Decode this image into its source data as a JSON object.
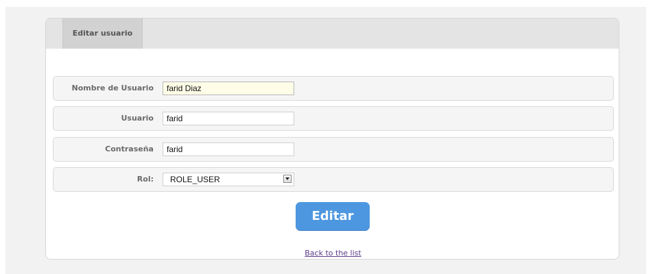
{
  "panel": {
    "tab_label": "Editar usuario"
  },
  "form": {
    "fields": [
      {
        "label": "Nombre de Usuario",
        "value": "farid Diaz"
      },
      {
        "label": "Usuario",
        "value": "farid"
      },
      {
        "label": "Contraseña",
        "value": "farid"
      }
    ],
    "role": {
      "label": "Rol:",
      "selected": "ROLE_USER"
    },
    "submit_label": "Editar"
  },
  "links": {
    "back": "Back to the list"
  },
  "colors": {
    "button": "#4d97e0",
    "link": "#5b3b8a",
    "focused_field": "#fefde7"
  }
}
